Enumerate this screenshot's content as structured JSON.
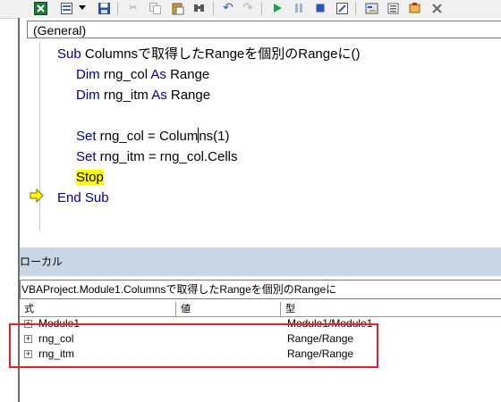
{
  "toolbar": {
    "icons": [
      "excel-icon",
      "insert-module-icon",
      "dropdown-arrow-icon",
      "save-icon",
      "cut-icon",
      "copy-icon",
      "paste-icon",
      "find-icon",
      "undo-icon",
      "redo-icon",
      "run-icon",
      "break-icon",
      "reset-icon",
      "design-mode-icon",
      "project-explorer-icon",
      "properties-icon",
      "object-browser-icon",
      "toolbox-icon"
    ]
  },
  "code_window": {
    "procedure_combo": "(General)",
    "lines": [
      {
        "kw1": "Sub",
        "text": " Columnsで取得したRangeを個別のRangeに()"
      },
      {
        "kw1": "Dim",
        "text1": " rng_col ",
        "kw2": "As",
        "text2": " Range"
      },
      {
        "kw1": "Dim",
        "text1": " rng_itm ",
        "kw2": "As",
        "text2": " Range"
      },
      {
        "kw1": "Set",
        "text_before_caret": " rng_col = Colum",
        "text_after_caret": "ns(1)"
      },
      {
        "kw1": "Set",
        "text": " rng_itm = rng_col.Cells"
      },
      {
        "text": "Stop"
      },
      {
        "kw1": "End Sub"
      }
    ]
  },
  "locals_window": {
    "title": "ローカル",
    "context": "VBAProject.Module1.Columnsで取得したRangeを個別のRangeに",
    "columns": [
      "式",
      "値",
      "型"
    ],
    "rows": [
      {
        "expression": "Module1",
        "value": "",
        "type": "Module1/Module1"
      },
      {
        "expression": "rng_col",
        "value": "",
        "type": "Range/Range"
      },
      {
        "expression": "rng_itm",
        "value": "",
        "type": "Range/Range"
      }
    ]
  },
  "colors": {
    "keyword": "#00008b",
    "stop_highlight": "#ffff00",
    "annotation_box": "#e0202a",
    "locals_title_bg": "#c9d6e6"
  }
}
